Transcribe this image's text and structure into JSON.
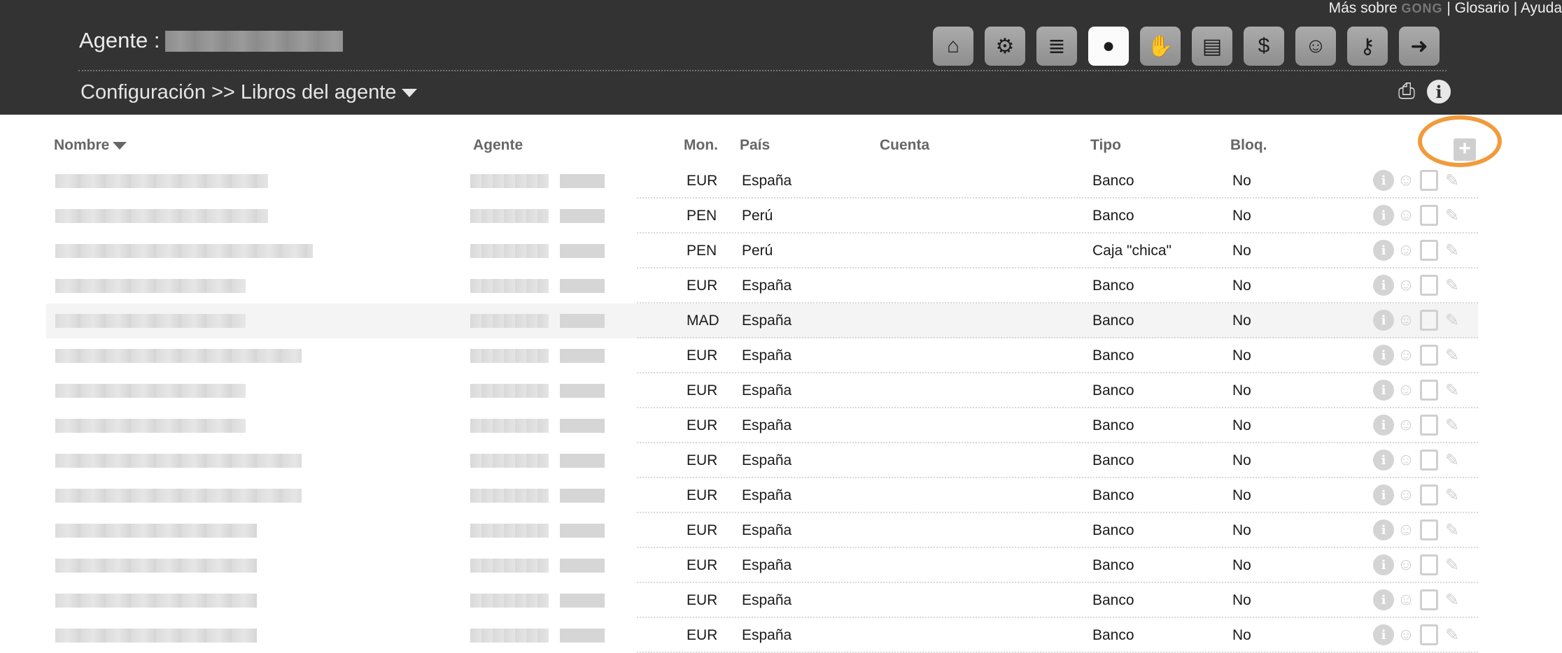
{
  "top_links": {
    "mas_sobre": "Más sobre",
    "brand": "GONG",
    "sep1": " | ",
    "glosario": "Glosario",
    "sep2": " | ",
    "ayuda": "Ayuda"
  },
  "header": {
    "agent_label": "Agente :",
    "breadcrumb": "Configuración >> Libros del agente"
  },
  "nav": [
    {
      "name": "home-icon",
      "glyph": "⌂"
    },
    {
      "name": "users-settings-icon",
      "glyph": "⚙"
    },
    {
      "name": "database-icon",
      "glyph": "≣"
    },
    {
      "name": "agent-icon",
      "glyph": "●"
    },
    {
      "name": "handshake-icon",
      "glyph": "✋"
    },
    {
      "name": "book-icon",
      "glyph": "▤"
    },
    {
      "name": "money-bag-icon",
      "glyph": "$"
    },
    {
      "name": "group-icon",
      "glyph": "☺"
    },
    {
      "name": "key-icon",
      "glyph": "⚷"
    },
    {
      "name": "exit-icon",
      "glyph": "➜"
    }
  ],
  "table": {
    "columns": {
      "nombre": "Nombre",
      "agente": "Agente",
      "moneda": "Mon.",
      "pais": "País",
      "cuenta": "Cuenta",
      "tipo": "Tipo",
      "bloqueado": "Bloq."
    },
    "rows": [
      {
        "moneda": "EUR",
        "pais": "España",
        "cuenta": "",
        "tipo": "Banco",
        "bloqueado": "No"
      },
      {
        "moneda": "PEN",
        "pais": "Perú",
        "cuenta": "",
        "tipo": "Banco",
        "bloqueado": "No"
      },
      {
        "moneda": "PEN",
        "pais": "Perú",
        "cuenta": "",
        "tipo": "Caja \"chica\"",
        "bloqueado": "No"
      },
      {
        "moneda": "EUR",
        "pais": "España",
        "cuenta": "",
        "tipo": "Banco",
        "bloqueado": "No"
      },
      {
        "moneda": "MAD",
        "pais": "España",
        "cuenta": "",
        "tipo": "Banco",
        "bloqueado": "No"
      },
      {
        "moneda": "EUR",
        "pais": "España",
        "cuenta": "",
        "tipo": "Banco",
        "bloqueado": "No"
      },
      {
        "moneda": "EUR",
        "pais": "España",
        "cuenta": "",
        "tipo": "Banco",
        "bloqueado": "No"
      },
      {
        "moneda": "EUR",
        "pais": "España",
        "cuenta": "",
        "tipo": "Banco",
        "bloqueado": "No"
      },
      {
        "moneda": "EUR",
        "pais": "España",
        "cuenta": "",
        "tipo": "Banco",
        "bloqueado": "No"
      },
      {
        "moneda": "EUR",
        "pais": "España",
        "cuenta": "",
        "tipo": "Banco",
        "bloqueado": "No"
      },
      {
        "moneda": "EUR",
        "pais": "España",
        "cuenta": "",
        "tipo": "Banco",
        "bloqueado": "No"
      },
      {
        "moneda": "EUR",
        "pais": "España",
        "cuenta": "",
        "tipo": "Banco",
        "bloqueado": "No"
      },
      {
        "moneda": "EUR",
        "pais": "España",
        "cuenta": "",
        "tipo": "Banco",
        "bloqueado": "No"
      },
      {
        "moneda": "EUR",
        "pais": "España",
        "cuenta": "",
        "tipo": "Banco",
        "bloqueado": "No"
      }
    ]
  },
  "colors": {
    "header_bg": "#333333",
    "highlight": "#f29a3c",
    "row_alt": "#f4f4f4"
  }
}
